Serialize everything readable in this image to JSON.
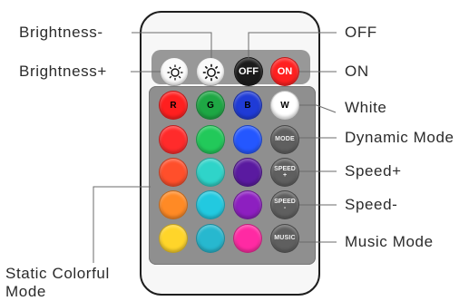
{
  "labels": {
    "brightness_minus": "Brightness-",
    "brightness_plus": "Brightness+",
    "off": "OFF",
    "on": "ON",
    "white": "White",
    "dynamic_mode": "Dynamic Mode",
    "speed_plus": "Speed+",
    "speed_minus": "Speed-",
    "music_mode": "Music Mode",
    "static_colorful_line1": "Static Colorful",
    "static_colorful_line2": "Mode"
  },
  "remote": {
    "top_buttons": {
      "brightness_down": "brightness-down-icon",
      "brightness_up": "brightness-up-icon",
      "off_label": "OFF",
      "on_label": "ON"
    },
    "rgb_row": {
      "red": "R",
      "green": "G",
      "blue": "B",
      "white": "W"
    },
    "function_buttons": {
      "mode": "MODE",
      "speed_up": "SPEED",
      "speed_up_sign": "+",
      "speed_down": "SPEED",
      "speed_down_sign": "-",
      "music": "MUSIC"
    },
    "colors": {
      "row1": [
        "#ff2b2b",
        "#22c95a",
        "#2457ff"
      ],
      "row2": [
        "#ff4f2b",
        "#2fd4c9",
        "#5a1aa0"
      ],
      "row3": [
        "#ff8a25",
        "#22c9e0",
        "#8d1fc0"
      ],
      "row4": [
        "#ffd52a",
        "#27b8cf",
        "#ff2aa3"
      ],
      "rgb": [
        "#ff1f1f",
        "#1ea744",
        "#1f3bd6"
      ],
      "white_button": "#ffffff",
      "off_button": "#1b1b1b",
      "on_button": "#ff2020"
    }
  }
}
